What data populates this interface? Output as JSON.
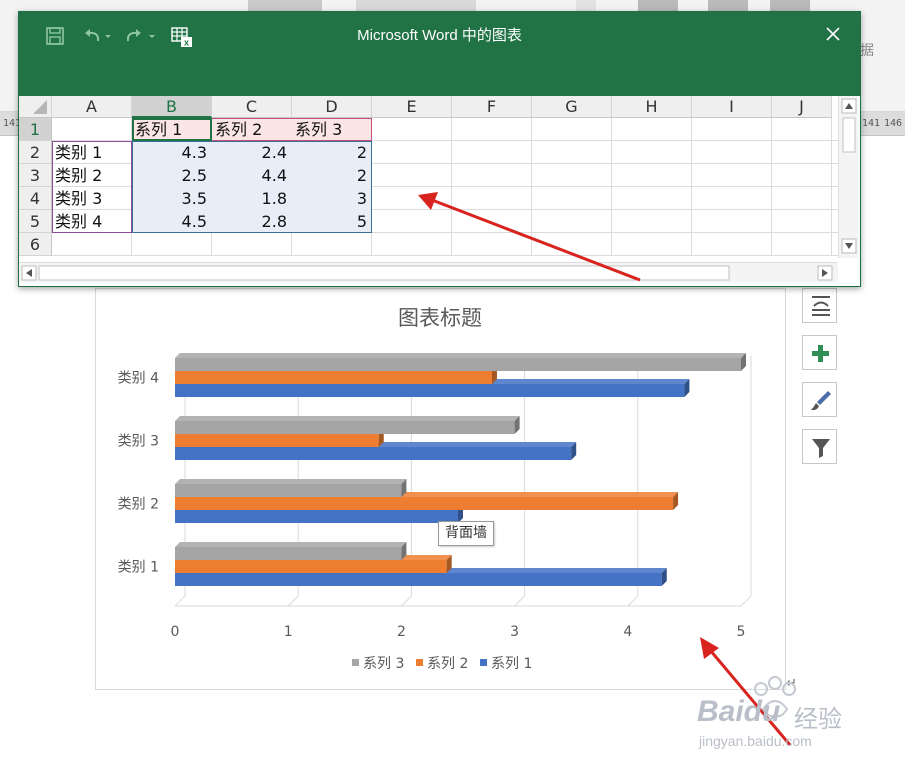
{
  "ribbon": {
    "partial_label": "据",
    "ruler_partial_left": "141",
    "ruler_partial_right": "146"
  },
  "window": {
    "title": "Microsoft Word 中的图表",
    "close_glyph": "✕"
  },
  "sheet": {
    "columns": [
      "A",
      "B",
      "C",
      "D",
      "E",
      "F",
      "G",
      "H",
      "I",
      "J"
    ],
    "rows": [
      "1",
      "2",
      "3",
      "4",
      "5",
      "6"
    ],
    "header_row": [
      "",
      "系列 1",
      "系列 2",
      "系列 3"
    ],
    "data_rows": [
      [
        "类别 1",
        "4.3",
        "2.4",
        "2"
      ],
      [
        "类别 2",
        "2.5",
        "4.4",
        "2"
      ],
      [
        "类别 3",
        "3.5",
        "1.8",
        "3"
      ],
      [
        "类别 4",
        "4.5",
        "2.8",
        "5"
      ]
    ]
  },
  "tooltip": {
    "text": "背面墙"
  },
  "tools": [
    "chart-layout-icon",
    "add-element-icon",
    "brush-style-icon",
    "filter-icon"
  ],
  "watermark": {
    "brand": "Baidu",
    "suffix": "经验",
    "url": "jingyan.baidu.com"
  },
  "colors": {
    "series1": "#4472c4",
    "series2": "#ed7d31",
    "series3": "#a5a5a5",
    "excel_green": "#217346",
    "arrow": "#d9231f"
  },
  "chart_data": {
    "type": "bar",
    "orientation": "horizontal",
    "title": "图表标题",
    "categories": [
      "类别 1",
      "类别 2",
      "类别 3",
      "类别 4"
    ],
    "series": [
      {
        "name": "系列 1",
        "values": [
          4.3,
          2.5,
          3.5,
          4.5
        ],
        "color": "#4472c4"
      },
      {
        "name": "系列 2",
        "values": [
          2.4,
          4.4,
          1.8,
          2.8
        ],
        "color": "#ed7d31"
      },
      {
        "name": "系列 3",
        "values": [
          2,
          2,
          3,
          5
        ],
        "color": "#a5a5a5"
      }
    ],
    "x_ticks": [
      "0",
      "1",
      "2",
      "3",
      "4",
      "5"
    ],
    "xlim": [
      0,
      5
    ],
    "legend": [
      "系列 3",
      "系列 2",
      "系列 1"
    ],
    "legend_position": "bottom",
    "grid": true
  }
}
